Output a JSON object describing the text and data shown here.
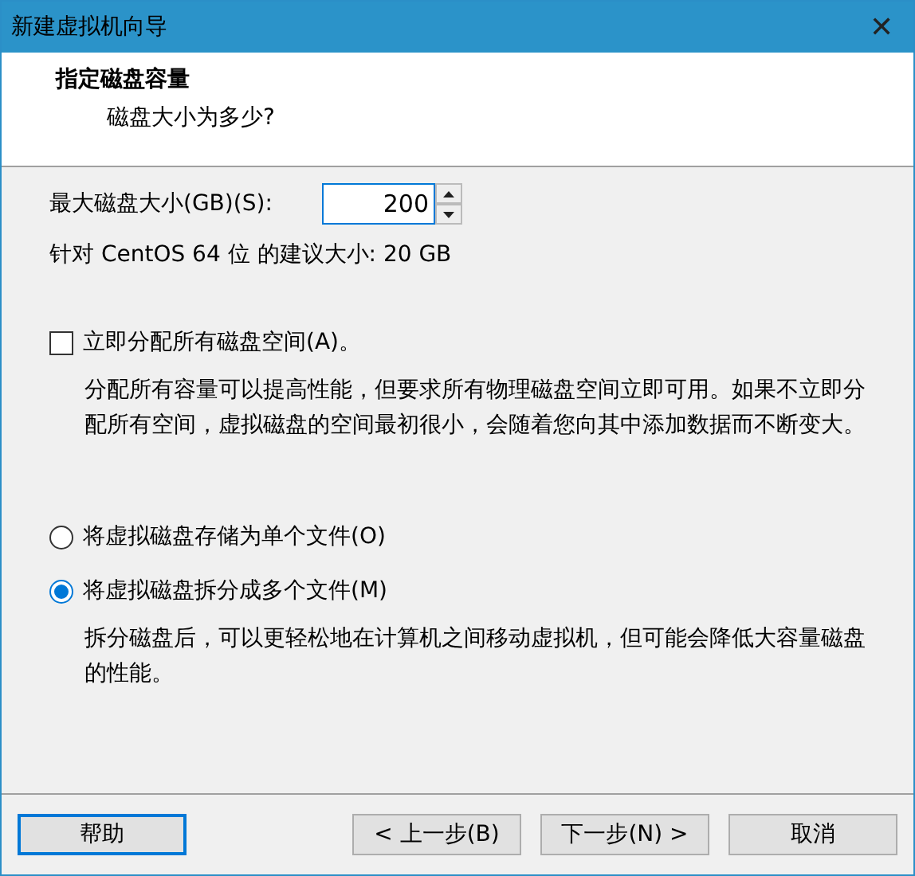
{
  "window": {
    "title": "新建虚拟机向导",
    "close": "✕"
  },
  "header": {
    "title": "指定磁盘容量",
    "subtitle": "磁盘大小为多少?"
  },
  "size_field": {
    "label": "最大磁盘大小(GB)(S):",
    "value": "200"
  },
  "recommendation": "针对 CentOS 64 位 的建议大小: 20 GB",
  "allocate": {
    "label": "立即分配所有磁盘空间(A)。",
    "checked": false,
    "description": "分配所有容量可以提高性能，但要求所有物理磁盘空间立即可用。如果不立即分配所有空间，虚拟磁盘的空间最初很小，会随着您向其中添加数据而不断变大。"
  },
  "storage_options": [
    {
      "label": "将虚拟磁盘存储为单个文件(O)",
      "selected": false
    },
    {
      "label": "将虚拟磁盘拆分成多个文件(M)",
      "selected": true,
      "description": "拆分磁盘后，可以更轻松地在计算机之间移动虚拟机，但可能会降低大容量磁盘的性能。"
    }
  ],
  "buttons": [
    {
      "label": "帮助",
      "focused": true
    },
    {
      "label": "< 上一步(B)",
      "focused": false
    },
    {
      "label": "下一步(N) >",
      "focused": false
    },
    {
      "label": "取消",
      "focused": false
    }
  ]
}
